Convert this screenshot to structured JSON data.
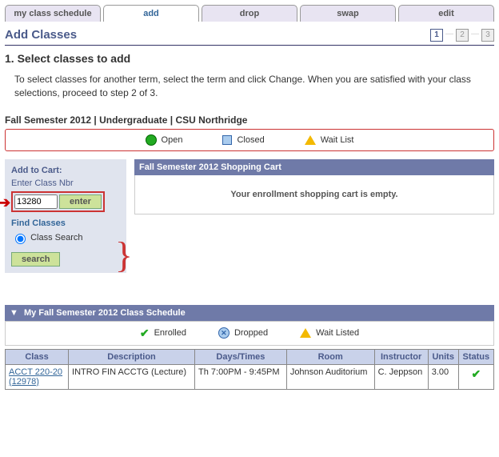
{
  "tabs": [
    "my class schedule",
    "add",
    "drop",
    "swap",
    "edit"
  ],
  "title": "Add Classes",
  "steps": [
    "1",
    "2",
    "3"
  ],
  "subtitle": "1.  Select classes to add",
  "instructions": "To select classes for another term, select the term and click Change.  When you are satisfied with your class selections, proceed to step 2 of 3.",
  "term_line": "Fall Semester 2012 | Undergraduate | CSU Northridge",
  "legend": {
    "open": "Open",
    "closed": "Closed",
    "wait": "Wait List"
  },
  "cart": {
    "add_label": "Add to Cart:",
    "enter_label": "Enter Class Nbr",
    "class_nbr": "13280",
    "enter_btn": "enter",
    "find_label": "Find Classes",
    "radio": "Class Search",
    "search_btn": "search",
    "header": "Fall Semester 2012 Shopping Cart",
    "empty": "Your enrollment shopping cart is empty."
  },
  "schedule": {
    "header": "My Fall Semester 2012 Class Schedule",
    "legend": {
      "enrolled": "Enrolled",
      "dropped": "Dropped",
      "wait": "Wait Listed"
    },
    "cols": [
      "Class",
      "Description",
      "Days/Times",
      "Room",
      "Instructor",
      "Units",
      "Status"
    ],
    "row": {
      "class_link": "ACCT 220-20",
      "class_id": "(12978)",
      "desc": "INTRO FIN ACCTG (Lecture)",
      "days": "Th 7:00PM - 9:45PM",
      "room": "Johnson Auditorium",
      "instr": "C. Jeppson",
      "units": "3.00"
    }
  }
}
